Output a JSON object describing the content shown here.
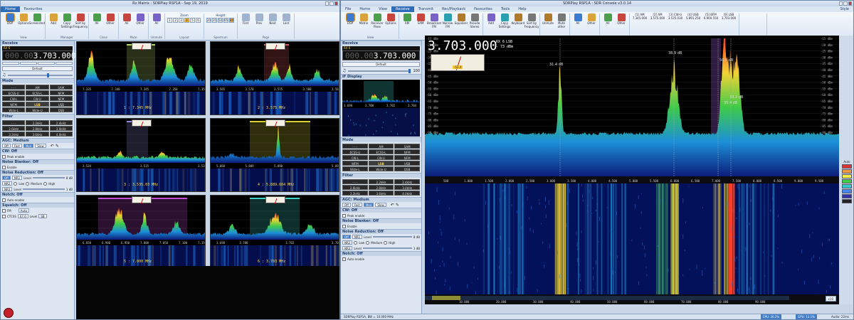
{
  "left": {
    "title": "Rx Matrix : SDRPlay RSP1A - Sep 19, 2019",
    "tabs": [
      "Home",
      "Favourites"
    ],
    "ribbon": {
      "groups": [
        {
          "name": "View",
          "items": [
            "DSP",
            "Options",
            "Screenshot"
          ]
        },
        {
          "name": "Manager",
          "items": [
            "Add",
            "Copy Settings",
            "Sort by Frequency"
          ]
        },
        {
          "name": "Close",
          "items": [
            "All",
            "Other"
          ]
        },
        {
          "name": "Mute",
          "items": [
            "All",
            "Other"
          ]
        },
        {
          "name": "Unmute",
          "items": [
            "All"
          ]
        }
      ],
      "zoom_label": "Zoom",
      "zoom_buttons": [
        "1",
        "2",
        "3",
        "4",
        "5",
        "6"
      ],
      "layout_label": "Layout",
      "height_label": "Height",
      "height_buttons": [
        "20",
        "35",
        "50",
        "65",
        "80"
      ],
      "spectrum_label": "Spectrum",
      "page_items": [
        "First",
        "Prev",
        "Next",
        "Last"
      ],
      "page_label": "Page"
    },
    "receive_title": "Receive",
    "rx_label": "RX 6",
    "freq_dim": "000.00",
    "freq_main": "3.703.000",
    "default_label": "Default",
    "mode_title": "Mode",
    "modes": [
      "- - -",
      "AM",
      "SAM",
      "ECSS-U",
      "ECSS-L",
      "NFM",
      "CW-L",
      "CW-U",
      "NFM",
      "WFM",
      "LSB",
      "USB",
      "Wide-L",
      "Wide-U",
      "DSB"
    ],
    "mode_selected": "LSB",
    "filter_title": "Filter",
    "filters": [
      "- - -",
      "2.2kHz",
      "2.4kHz",
      "2.6kHz",
      "2.8kHz",
      "3.0kHz",
      "3.2kHz",
      "3.6kHz",
      "4.0kHz"
    ],
    "agc_title": "AGC: Medium",
    "agc_buttons": [
      "Off",
      "Fast",
      "Med",
      "Slow"
    ],
    "agc_selected": "Med",
    "cw_title": "CW: Off",
    "cw_peak": "Peak enable",
    "nb_title": "Noise Blanker: Off",
    "nb_enable": "Enable",
    "nr_title": "Noise Reduction: Off",
    "nr_buttons": [
      "Off",
      "NR1"
    ],
    "nr_level": "Level",
    "nr_db": "8 dB",
    "nr2": "NR2",
    "nr2_opts": [
      "Low",
      "Medium",
      "High"
    ],
    "nr3": "NR3",
    "nr3_level": "Level",
    "nr3_db": "1 dB",
    "notch_title": "Notch: Off",
    "notch_auto": "Auto enable",
    "squelch_title": "Squelch: Off",
    "sq_fm": "FM",
    "sq_auto": "Auto",
    "sq_ctcss": "CTCSS",
    "sq_ctcss_val": "67.0",
    "sq_level": "Level",
    "sq_level_val": "SB",
    "cells": [
      {
        "label": "1 : 7.345 MHz",
        "ticks": [
          "7.335",
          "7.340",
          "7.345",
          "7.350",
          "7.355"
        ],
        "hue": "#b8d96a"
      },
      {
        "label": "2 : 3.575 MHz",
        "ticks": [
          "3.565",
          "3.570",
          "3.575",
          "3.580",
          "3.585"
        ],
        "hue": "#e35b5b"
      },
      {
        "label": "3 : 3.535.03 MHz",
        "ticks": [
          "3.534",
          "",
          "3.535",
          "",
          "3.536"
        ],
        "hue": "#8a8ad8"
      },
      {
        "label": "4 : 5.889.664 MHz",
        "ticks": [
          "5.888",
          "5.889",
          "5.890",
          "",
          "5.892"
        ],
        "hue": "#d8d030"
      },
      {
        "label": "5 : 7.000 MHz",
        "ticks": [
          "6.850",
          "6.900",
          "6.950",
          "7.000",
          "7.050",
          "7.100",
          "7.150"
        ],
        "hue": "#c24fd4"
      },
      {
        "label": "6 : 3.703 MHz",
        "ticks": [
          "3.698",
          "3.700",
          "",
          "3.702",
          "",
          "3.704"
        ],
        "hue": "#3fd0c8"
      }
    ]
  },
  "right": {
    "title": "SDRPlay RSP1A : SDR Console v3.0.14",
    "tabs": [
      "File",
      "Home",
      "View",
      "Receive",
      "Transmit",
      "Rec/Playback",
      "Favourites",
      "Tools",
      "Help"
    ],
    "tab_active": "Receive",
    "style_label": "Style",
    "ribbon_groups": [
      {
        "name": "View",
        "items": [
          "DSP",
          "Matrix",
          "Receiver Pane",
          "Options"
        ]
      },
      {
        "name": "Mode",
        "items": [
          "AM",
          "SAM",
          "Broadcast FM",
          "Narrow FM",
          "Equaliser",
          "Pseudo Stereo"
        ]
      },
      {
        "name": "Manager",
        "items": [
          "Add",
          "Copy Settings",
          "Keyboard",
          "Sort by Frequency"
        ]
      },
      {
        "name": "Select RX",
        "items": [
          "Unmute",
          "Mute other"
        ]
      },
      {
        "name": "Close",
        "items": [
          "All",
          "Other"
        ]
      },
      {
        "name": "Mute",
        "items": [
          "All",
          "Other"
        ]
      }
    ],
    "receivers_label": "Receivers",
    "receivers": [
      {
        "id": "[1] AM",
        "f": "7.345.000"
      },
      {
        "id": "[2] AM",
        "f": "3.575.000"
      },
      {
        "id": "[3] CW-U",
        "f": "3.535.030"
      },
      {
        "id": "[4] USB",
        "f": "5.891.250"
      },
      {
        "id": "[5] BFM",
        "f": "6.900.550"
      },
      {
        "id": "[6] LSB",
        "f": "3.703.000"
      }
    ],
    "receivers_range": "Receivers 6 - 10",
    "receive_title": "Receive",
    "rx_label": "RX 6",
    "freq_dim": "000.00",
    "freq_main": "3.703.000",
    "default_label": "Default",
    "volume": "100",
    "ifdisplay_title": "IF Display",
    "if_ticks": [
      "3.698",
      "3.700",
      "3.702",
      "3.704"
    ],
    "main_freq": "3.703.000",
    "main_rx": "RX 6",
    "main_mode": "LSB",
    "main_dbm": "- 73 dBm",
    "smeter_value": "-52.4",
    "peaks": [
      {
        "label": "31.4 dB"
      },
      {
        "label": "38.9 dB"
      },
      {
        "label": "50.8 dB"
      },
      {
        "label": "33.2 dB"
      },
      {
        "label": "35.4 dB"
      }
    ],
    "db_scale": [
      "-15 dBm",
      "-20 dBm",
      "-25 dBm",
      "-30 dBm",
      "-35 dBm",
      "-40 dBm",
      "-45 dBm",
      "-50 dBm",
      "-55 dBm",
      "-60 dBm",
      "-65 dBm",
      "-70 dBm",
      "-75 dBm",
      "-80 dBm",
      "-85 dBm",
      "-90 dBm",
      "-95 dBm",
      "-100 dBm",
      "-105 dBm",
      "-110 dBm",
      "-115 dBm",
      "-120 dBm"
    ],
    "freq_axis": [
      "500",
      "1.000",
      "1.500",
      "2.000",
      "2.500",
      "3.000",
      "3.500",
      "4.000",
      "4.500",
      "5.000",
      "5.500",
      "6.000",
      "6.500",
      "7.000",
      "7.500",
      "8.000",
      "8.500",
      "9.000",
      "9.500"
    ],
    "bottom_axis": [
      "10.000",
      "20.000",
      "30.000",
      "40.000",
      "50.000",
      "60.000",
      "70.000",
      "80.000",
      "90.000"
    ],
    "status_text": "SDRPlay RSP1A, BW = 10.000 MHz",
    "cpu": "CPU: 20.2%",
    "gpu": "GPU: 13.1%",
    "audio": "Audio: 22ms",
    "zoom_box": "x10",
    "auto_label": "Auto"
  }
}
